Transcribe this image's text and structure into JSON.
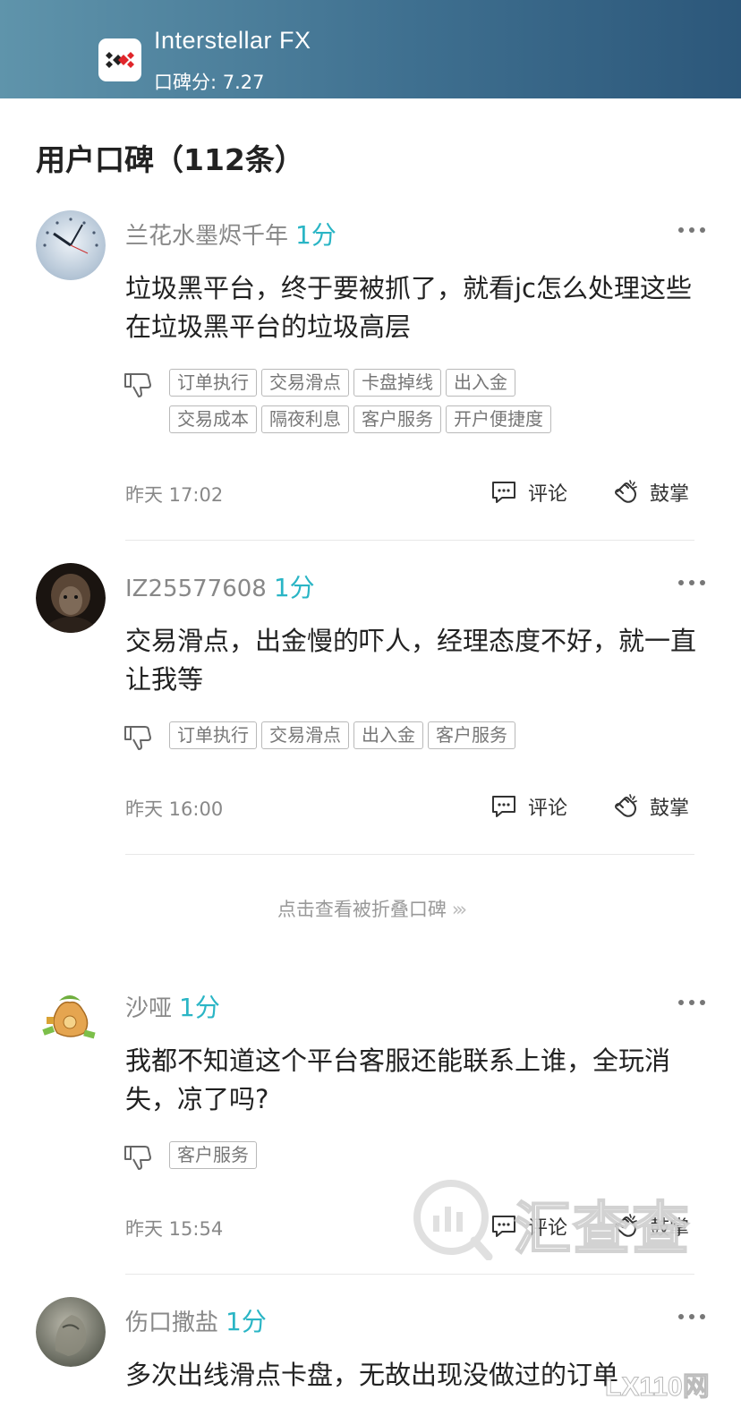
{
  "header": {
    "broker_name": "Interstellar FX",
    "score_label": "口碑分: 7.27",
    "logo_icon": "interstellar-fx-logo"
  },
  "section": {
    "title": "用户口碑（112条）"
  },
  "reviews": [
    {
      "username": "兰花水墨烬千年",
      "score": "1分",
      "content": "垃圾黑平台，终于要被抓了，就看jc怎么处理这些在垃圾黑平台的垃圾高层",
      "tags": [
        "订单执行",
        "交易滑点",
        "卡盘掉线",
        "出入金",
        "交易成本",
        "隔夜利息",
        "客户服务",
        "开户便捷度"
      ],
      "time": "昨天 17:02",
      "comment_label": "评论",
      "clap_label": "鼓掌",
      "avatar_icon": "clock-avatar"
    },
    {
      "username": "IZ25577608",
      "score": "1分",
      "content": "交易滑点，出金慢的吓人，经理态度不好，就一直让我等",
      "tags": [
        "订单执行",
        "交易滑点",
        "出入金",
        "客户服务"
      ],
      "time": "昨天 16:00",
      "comment_label": "评论",
      "clap_label": "鼓掌",
      "avatar_icon": "portrait-avatar"
    },
    {
      "username": "沙哑",
      "score": "1分",
      "content": "我都不知道这个平台客服还能联系上谁，全玩消失，凉了吗?",
      "tags": [
        "客户服务"
      ],
      "time": "昨天 15:54",
      "comment_label": "评论",
      "clap_label": "鼓掌",
      "avatar_icon": "money-bag-avatar"
    },
    {
      "username": "伤口撒盐",
      "score": "1分",
      "content": "多次出线滑点卡盘，无故出现没做过的订单",
      "avatar_icon": "stone-avatar"
    }
  ],
  "folded": {
    "label": "点击查看被折叠口碑",
    "icon": "double-chevron-right-icon"
  },
  "watermark": {
    "text": "汇查查",
    "corner_text": "LX110网"
  },
  "colors": {
    "header_start": "#5f94ab",
    "header_end": "#2c577a",
    "score_accent": "#2ab5c5"
  }
}
